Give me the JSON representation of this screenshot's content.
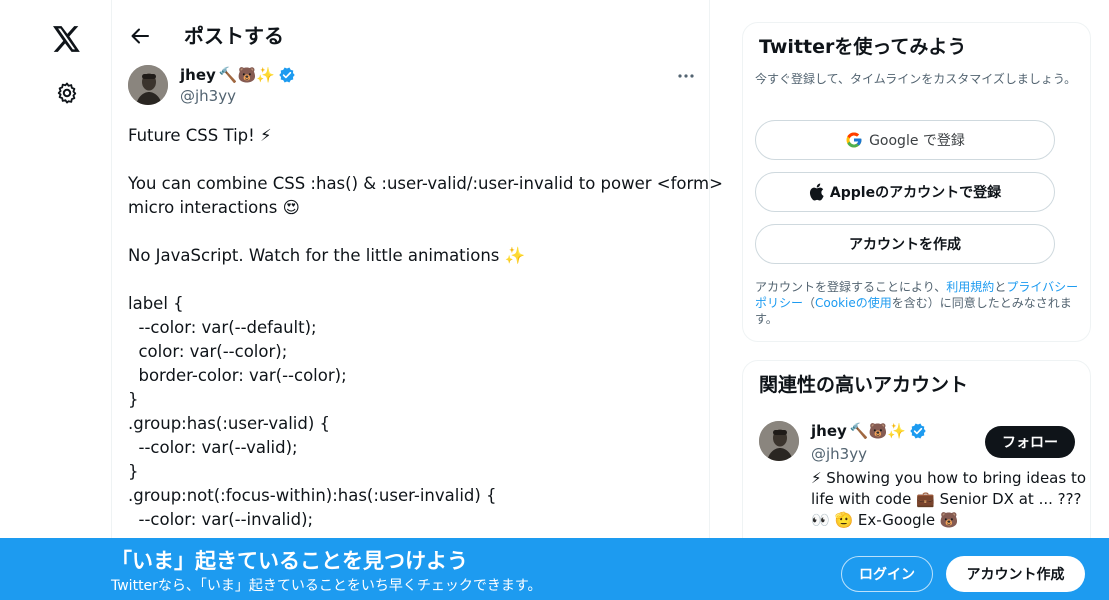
{
  "header": {
    "title": "ポストする"
  },
  "tweet": {
    "author_name": "jhey",
    "author_emojis": "🔨🐻✨",
    "author_handle": "@jh3yy",
    "lines": [
      "Future CSS Tip! ⚡",
      "",
      "You can combine CSS :has() & :user-valid/:user-invalid to power <form>",
      "micro interactions 😍",
      "",
      "No JavaScript. Watch for the little animations ✨",
      "",
      "label {",
      "  --color: var(--default);",
      "  color: var(--color);",
      "  border-color: var(--color);",
      "}",
      ".group:has(:user-valid) {",
      "  --color: var(--valid);",
      "}",
      ".group:not(:focus-within):has(:user-invalid) {",
      "  --color: var(--invalid);"
    ]
  },
  "signup_card": {
    "title": "Twitterを使ってみよう",
    "subtitle": "今すぐ登録して、タイムラインをカスタマイズしましょう。",
    "google_label": "Google で登録",
    "apple_label": "Appleのアカウントで登録",
    "create_label": "アカウントを作成",
    "legal_prefix": "アカウントを登録することにより、",
    "legal_terms": "利用規約",
    "legal_and": "と",
    "legal_privacy": "プライバシーポリシー",
    "legal_open": "（",
    "legal_cookie": "Cookieの使用",
    "legal_suffix": "を含む）に同意したとみなされます。"
  },
  "related": {
    "title": "関連性の高いアカウント",
    "name": "jhey",
    "emojis": "🔨🐻✨",
    "handle": "@jh3yy",
    "follow_label": "フォロー",
    "bio_lines": [
      "⚡ Showing you how to bring ideas to",
      "life with code 💼 Senior DX at ... ???",
      "👀 🫡 Ex-Google 🐻"
    ]
  },
  "banner": {
    "title": "「いま」起きていることを見つけよう",
    "subtitle": "Twitterなら、「いま」起きていることをいち早くチェックできます。",
    "login_label": "ログイン",
    "signup_label": "アカウント作成"
  },
  "colors": {
    "accent": "#1d9bf0",
    "text": "#0f1419",
    "muted": "#536471",
    "verified": "#1d9bf0"
  }
}
